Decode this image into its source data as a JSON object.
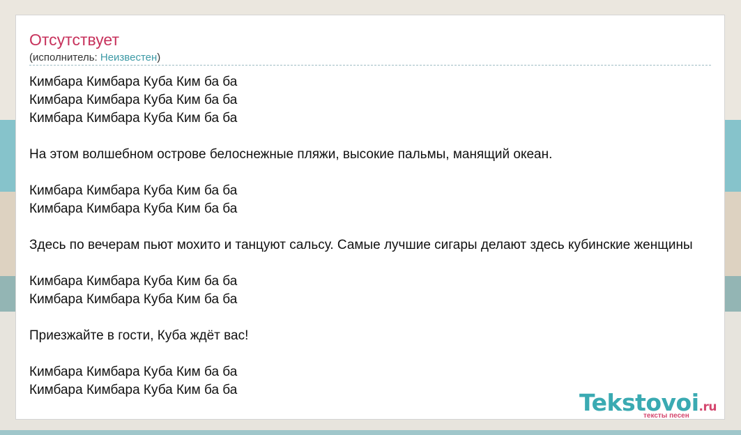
{
  "song": {
    "title": "Отсутствует",
    "artist_prefix": "(исполнитель: ",
    "artist_name": "Неизвестен",
    "artist_suffix": ")"
  },
  "lyrics": [
    "Кимбара Кимбара Куба Ким ба ба",
    "Кимбара Кимбара Куба Ким ба ба",
    "Кимбара Кимбара Куба Ким ба ба",
    "",
    "На этом волшебном острове белоснежные пляжи, высокие пальмы, манящий океан.",
    "",
    "Кимбара Кимбара Куба Ким ба ба",
    "Кимбара Кимбара Куба Ким ба ба",
    "",
    "Здесь по вечерам пьют мохито и танцуют сальсу. Самые лучшие сигары делают здесь кубинские женщины",
    "",
    "Кимбара Кимбара Куба Ким ба ба",
    "Кимбара Кимбара Куба Ким ба ба",
    "",
    "Приезжайте в гости, Куба ждёт вас!",
    "",
    "Кимбара Кимбара Куба Ким ба ба",
    "Кимбара Кимбара Куба Ким ба ба"
  ],
  "logo": {
    "main": "Tekstovoi",
    "domain": ".ru",
    "tagline": "тексты песен"
  },
  "colors": {
    "title": "#c7325c",
    "link": "#3d9aa6",
    "logo_main": "#3aaab2",
    "logo_accent": "#d4466e"
  }
}
